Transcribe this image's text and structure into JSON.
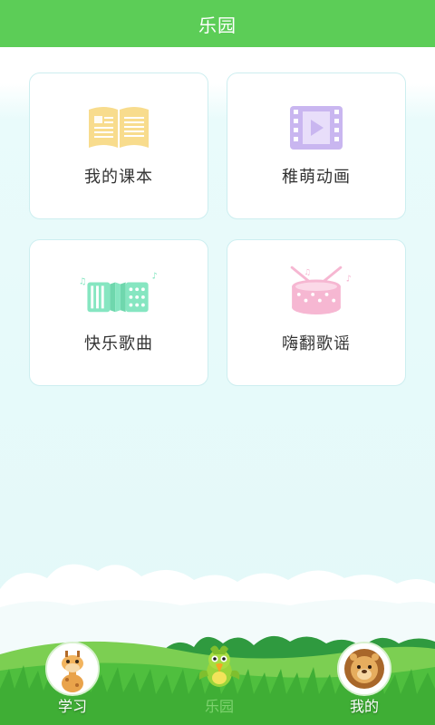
{
  "header": {
    "title": "乐园"
  },
  "cards": [
    {
      "label": "我的课本",
      "icon": "open-book-icon",
      "color": "#f8dc8d"
    },
    {
      "label": "稚萌动画",
      "icon": "video-film-icon",
      "color": "#c9b6f0"
    },
    {
      "label": "快乐歌曲",
      "icon": "accordion-icon",
      "color": "#86e6c1"
    },
    {
      "label": "嗨翻歌谣",
      "icon": "drum-icon",
      "color": "#f6b7d2"
    }
  ],
  "tabs": [
    {
      "label": "学习",
      "icon": "giraffe-avatar-icon",
      "active": false
    },
    {
      "label": "乐园",
      "icon": "parrot-avatar-icon",
      "active": true
    },
    {
      "label": "我的",
      "icon": "lion-avatar-icon",
      "active": false
    }
  ],
  "colors": {
    "accent": "#5ccd57",
    "tab_active": "#7ed36f",
    "grass": "#4fbf3e"
  }
}
